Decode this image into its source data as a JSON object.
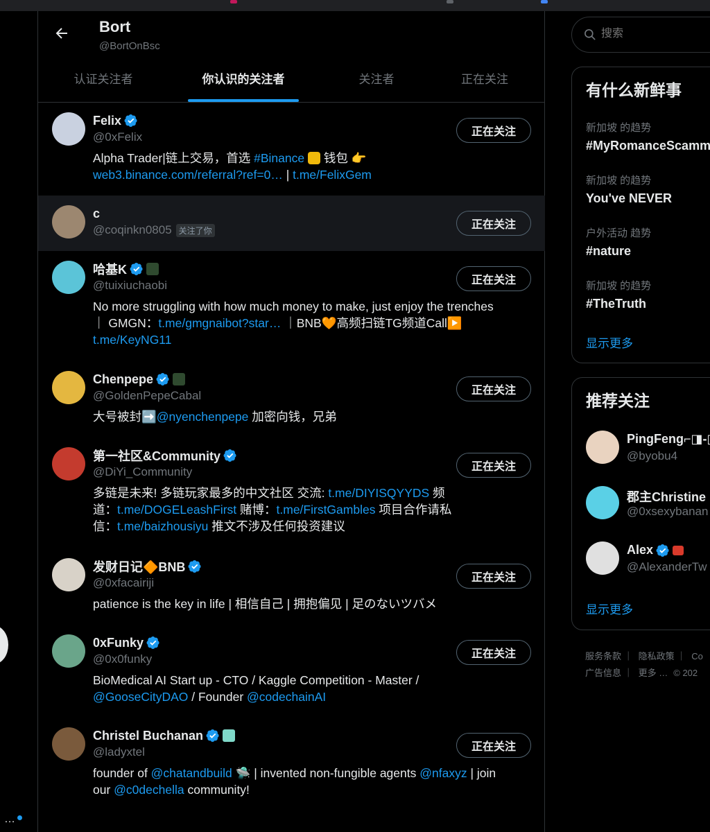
{
  "colors": {
    "accent": "#1d9bf0",
    "background": "#000000",
    "border": "#2f3336",
    "muted": "#71767b"
  },
  "profile": {
    "name": "Bort",
    "handle": "@BortOnBsc"
  },
  "tabs": [
    {
      "label": "认证关注者",
      "active": false
    },
    {
      "label": "你认识的关注者",
      "active": true
    },
    {
      "label": "关注者",
      "active": false
    },
    {
      "label": "正在关注",
      "active": false
    }
  ],
  "users": [
    {
      "name": "Felix",
      "handle": "@0xFelix",
      "verified": true,
      "follow_label": "正在关注",
      "bio": [
        {
          "t": "Alpha Trader|链上交易，首选 "
        },
        {
          "t": "#Binance",
          "link": true
        },
        {
          "t": " ",
          "emoji": "#f0b90b"
        },
        {
          "t": " 钱包 👉"
        },
        {
          "br": true
        },
        {
          "t": "web3.binance.com/referral?ref=0…",
          "link": true
        },
        {
          "t": " | "
        },
        {
          "t": "t.me/FelixGem",
          "link": true
        }
      ]
    },
    {
      "name": "c",
      "handle": "@coqinkn0805",
      "follows_you": "关注了你",
      "verified": false,
      "follow_label": "正在关注",
      "bio": []
    },
    {
      "name": "哈基K",
      "handle": "@tuixiuchaobi",
      "verified": true,
      "follow_label": "正在关注",
      "bio": [
        {
          "t": "No more struggling with how much money to make, just enjoy the trenches"
        },
        {
          "br": true
        },
        {
          "t": "｜ GMGN："
        },
        {
          "t": "t.me/gmgnaibot?star…",
          "link": true
        },
        {
          "t": " ｜BNB🧡高频扫链TG频道Call▶️"
        },
        {
          "br": true
        },
        {
          "t": "t.me/KeyNG11",
          "link": true
        }
      ]
    },
    {
      "name": "Chenpepe",
      "handle": "@GoldenPepeCabal",
      "verified": true,
      "follow_label": "正在关注",
      "bio": [
        {
          "t": "大号被封➡️"
        },
        {
          "t": "@nyenchenpepe",
          "link": true
        },
        {
          "t": " 加密向钱，兄弟"
        }
      ]
    },
    {
      "name": "第一社区&Community",
      "handle": "@DiYi_Community",
      "verified": true,
      "follow_label": "正在关注",
      "bio": [
        {
          "t": "多链是未来! 多链玩家最多的中文社区 交流: "
        },
        {
          "t": "t.me/DIYISQYYDS",
          "link": true
        },
        {
          "t": " 频"
        },
        {
          "br": true
        },
        {
          "t": "道："
        },
        {
          "t": "t.me/DOGELeashFirst",
          "link": true
        },
        {
          "t": " 赌博："
        },
        {
          "t": "t.me/FirstGambles",
          "link": true
        },
        {
          "t": " 项目合作请私"
        },
        {
          "br": true
        },
        {
          "t": "信："
        },
        {
          "t": "t.me/baizhousiyu",
          "link": true
        },
        {
          "t": " 推文不涉及任何投资建议"
        }
      ]
    },
    {
      "name": "发财日记🔶BNB",
      "handle": "@0xfacairiji",
      "verified": true,
      "follow_label": "正在关注",
      "bio": [
        {
          "t": "patience is the key in life | 相信自己 | 拥抱偏见 | 足のないツバメ"
        }
      ]
    },
    {
      "name": "0xFunky",
      "handle": "@0x0funky",
      "verified": true,
      "follow_label": "正在关注",
      "bio": [
        {
          "t": "BioMedical AI Start up - CTO / Kaggle Competition - Master /"
        },
        {
          "br": true
        },
        {
          "t": "@GooseCityDAO",
          "link": true
        },
        {
          "t": " / Founder "
        },
        {
          "t": "@codechainAI",
          "link": true
        }
      ]
    },
    {
      "name": "Christel Buchanan",
      "handle": "@ladyxtel",
      "verified": true,
      "follow_label": "正在关注",
      "bio": [
        {
          "t": "founder of "
        },
        {
          "t": "@chatandbuild",
          "link": true
        },
        {
          "t": " 🛸 | invented non-fungible agents "
        },
        {
          "t": "@nfaxyz",
          "link": true
        },
        {
          "t": " | join"
        },
        {
          "br": true
        },
        {
          "t": "our "
        },
        {
          "t": "@c0dechella",
          "link": true
        },
        {
          "t": " community!"
        }
      ]
    }
  ],
  "search": {
    "placeholder": "搜索"
  },
  "trends_card": {
    "title": "有什么新鲜事",
    "items": [
      {
        "context": "新加坡 的趋势",
        "name": "#MyRomanceScamm"
      },
      {
        "context": "新加坡 的趋势",
        "name": "You've NEVER"
      },
      {
        "context": "户外活动 趋势",
        "name": "#nature"
      },
      {
        "context": "新加坡 的趋势",
        "name": "#TheTruth"
      }
    ],
    "show_more": "显示更多"
  },
  "suggest_card": {
    "title": "推荐关注",
    "items": [
      {
        "name": "PingFeng⌐◨-◨",
        "handle": "@byobu4",
        "verified": false
      },
      {
        "name": "郡主Christine",
        "handle": "@0xsexybanan",
        "verified": false
      },
      {
        "name": "Alex",
        "handle": "@AlexanderTw",
        "verified": true
      }
    ],
    "show_more": "显示更多"
  },
  "footer": {
    "line1": [
      "服务条款 ｜",
      "隐私政策 ｜",
      "Co"
    ],
    "line2": [
      "广告信息 ｜",
      "更多 …",
      "© 202"
    ]
  }
}
